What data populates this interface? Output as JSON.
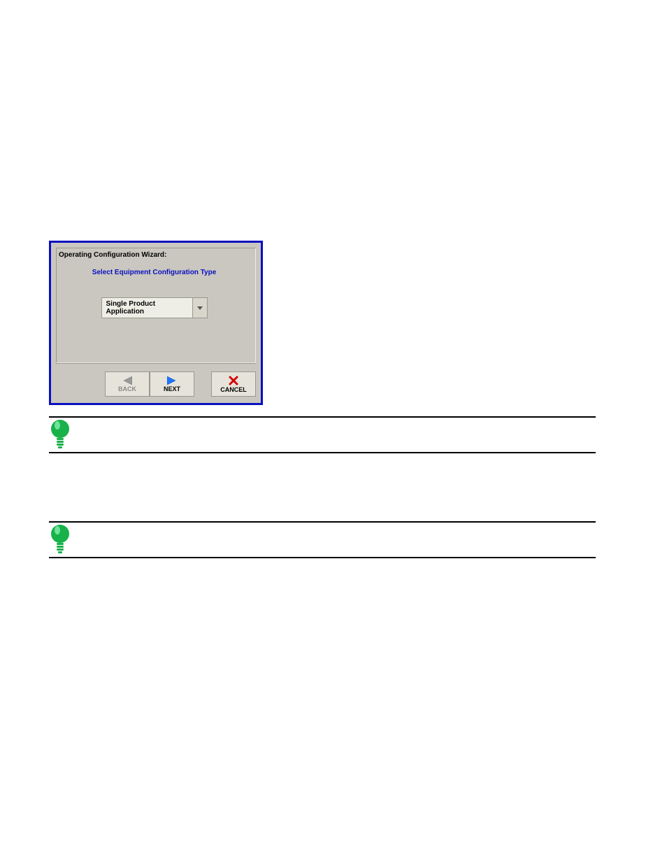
{
  "wizard": {
    "title": "Operating Configuration Wizard:",
    "prompt": "Select Equipment Configuration Type",
    "selected_option": "Single Product Application",
    "buttons": {
      "back": "BACK",
      "next": "NEXT",
      "cancel": "CANCEL"
    }
  }
}
